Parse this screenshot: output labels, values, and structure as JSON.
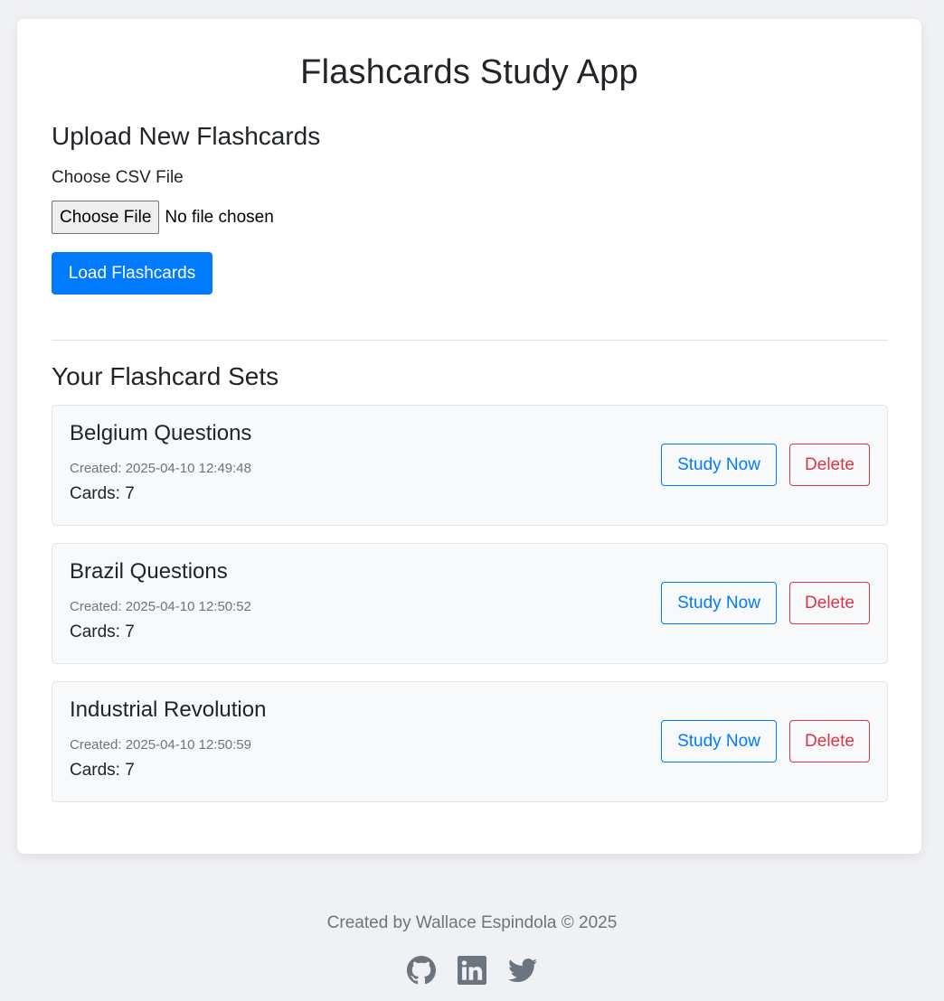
{
  "app": {
    "title": "Flashcards Study App"
  },
  "upload": {
    "heading": "Upload New Flashcards",
    "file_label": "Choose CSV File",
    "file_button": "Choose File",
    "file_status": "No file chosen",
    "load_button": "Load Flashcards"
  },
  "sets": {
    "heading": "Your Flashcard Sets",
    "items": [
      {
        "name": "Belgium Questions",
        "created": "Created: 2025-04-10 12:49:48",
        "cards": "Cards: 7",
        "study_label": "Study Now",
        "delete_label": "Delete"
      },
      {
        "name": "Brazil Questions",
        "created": "Created: 2025-04-10 12:50:52",
        "cards": "Cards: 7",
        "study_label": "Study Now",
        "delete_label": "Delete"
      },
      {
        "name": "Industrial Revolution",
        "created": "Created: 2025-04-10 12:50:59",
        "cards": "Cards: 7",
        "study_label": "Study Now",
        "delete_label": "Delete"
      }
    ]
  },
  "footer": {
    "text": "Created by Wallace Espindola © 2025",
    "icons": [
      "github-icon",
      "linkedin-icon",
      "twitter-icon"
    ]
  },
  "colors": {
    "primary": "#007bff",
    "danger": "#dc3545",
    "muted": "#6c757d",
    "background": "#f0f1f5"
  }
}
